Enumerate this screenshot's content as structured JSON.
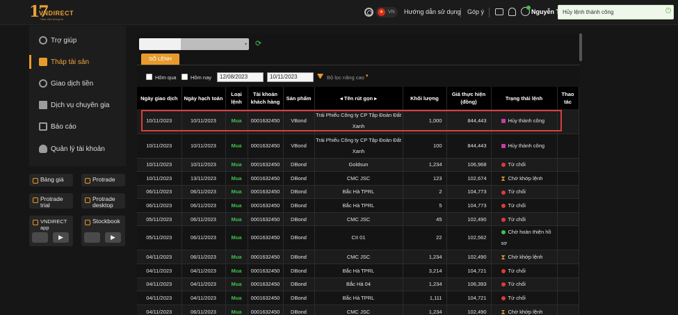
{
  "header": {
    "logo_number": "17",
    "logo_brand": "VNDIRECT",
    "logo_tagline": "Giao dịch thông tin",
    "lang_code": "VN",
    "guide_link": "Hướng dẫn sử dụng",
    "feedback_link": "Góp ý",
    "user_name": "Nguyễn Th"
  },
  "toast": {
    "message": "Hủy lệnh thành công"
  },
  "sidebar": {
    "items": [
      {
        "label": "Trợ giúp",
        "icon": "help-icon"
      },
      {
        "label": "Tháp tài sản",
        "icon": "tower-icon",
        "active": true
      },
      {
        "label": "Giao dịch tiền",
        "icon": "money-icon"
      },
      {
        "label": "Dịch vụ chuyên gia",
        "icon": "book-icon"
      },
      {
        "label": "Báo cáo",
        "icon": "report-icon"
      },
      {
        "label": "Quản lý tài khoản",
        "icon": "person-icon"
      }
    ],
    "quick_links": [
      {
        "label": "Bảng giá"
      },
      {
        "label": "Protrade"
      },
      {
        "label": "Protrade trial"
      },
      {
        "label": "Protrade desktop"
      },
      {
        "label": "VNDIRECT app"
      },
      {
        "label": "Stockbook"
      }
    ]
  },
  "main": {
    "tab_label": "SỔ LỆNH",
    "filters": {
      "today_label": "Hôm qua",
      "yesterday_label": "Hôm nay",
      "from_date": "12/08/2023",
      "to_date": "10/11/2023",
      "advanced_label": "Bộ lọc nâng cao"
    },
    "table": {
      "headers": [
        "Ngày giao dịch",
        "Ngày hạch toán",
        "Loại lệnh",
        "Tài khoản khách hàng",
        "Sản phẩm",
        "◂  Tên rút gọn  ▸",
        "Khối lượng",
        "Giá thực hiện (đồng)",
        "Trạng thái lệnh",
        "Thao tác"
      ],
      "rows": [
        [
          "10/11/2023",
          "10/11/2023",
          "Mua",
          "0001632450",
          "VBond",
          "Trái Phiếu Công ty CP Tập Đoàn Đất Xanh",
          "1,000",
          "844,443",
          "Hủy thành công"
        ],
        [
          "10/11/2023",
          "10/11/2023",
          "Mua",
          "0001632450",
          "VBond",
          "Trái Phiếu Công ty CP Tập Đoàn Đất Xanh",
          "100",
          "844,443",
          "Hủy thành công"
        ],
        [
          "10/11/2023",
          "10/11/2023",
          "Mua",
          "0001632450",
          "DBond",
          "Goldsun",
          "1,234",
          "106,968",
          "Từ chối"
        ],
        [
          "10/11/2023",
          "13/11/2023",
          "Mua",
          "0001632450",
          "DBond",
          "CMC JSC",
          "123",
          "102,674",
          "Chờ khớp lệnh"
        ],
        [
          "06/11/2023",
          "06/11/2023",
          "Mua",
          "0001632450",
          "DBond",
          "Bắc Hà TPRL",
          "2",
          "104,773",
          "Từ chối"
        ],
        [
          "06/11/2023",
          "06/11/2023",
          "Mua",
          "0001632450",
          "DBond",
          "Bắc Hà TPRL",
          "5",
          "104,773",
          "Từ chối"
        ],
        [
          "05/11/2023",
          "06/11/2023",
          "Mua",
          "0001632450",
          "DBond",
          "CMC JSC",
          "45",
          "102,490",
          "Từ chối"
        ],
        [
          "05/11/2023",
          "06/11/2023",
          "Mua",
          "0001632450",
          "DBond",
          "CII 01",
          "22",
          "102,562",
          "Chờ hoàn thiện hồ sơ"
        ],
        [
          "04/11/2023",
          "06/11/2023",
          "Mua",
          "0001632450",
          "DBond",
          "CMC JSC",
          "1,234",
          "102,490",
          "Chờ khớp lệnh"
        ],
        [
          "04/11/2023",
          "04/11/2023",
          "Mua",
          "0001632450",
          "DBond",
          "Bắc Hà TPRL",
          "3,214",
          "104,721",
          "Từ chối"
        ],
        [
          "04/11/2023",
          "04/11/2023",
          "Mua",
          "0001632450",
          "DBond",
          "Bắc Hà 04",
          "1,234",
          "106,393",
          "Từ chối"
        ],
        [
          "04/11/2023",
          "04/11/2023",
          "Mua",
          "0001632450",
          "DBond",
          "Bắc Hà TPRL",
          "1,111",
          "104,721",
          "Từ chối"
        ],
        [
          "04/11/2023",
          "06/11/2023",
          "Mua",
          "0001632450",
          "DBond",
          "CMC JSC",
          "1,234",
          "102,490",
          "Chờ khớp lệnh"
        ]
      ],
      "status_icons": {
        "Hủy thành công": "trash-icon",
        "Từ chối": "reject-icon",
        "Chờ khớp lệnh": "hourglass-icon",
        "Chờ hoàn thiện hồ sơ": "check-circle-icon"
      }
    }
  },
  "colors": {
    "accent": "#e89b2d",
    "buy": "#3ec24c",
    "highlight": "#d8403f"
  }
}
